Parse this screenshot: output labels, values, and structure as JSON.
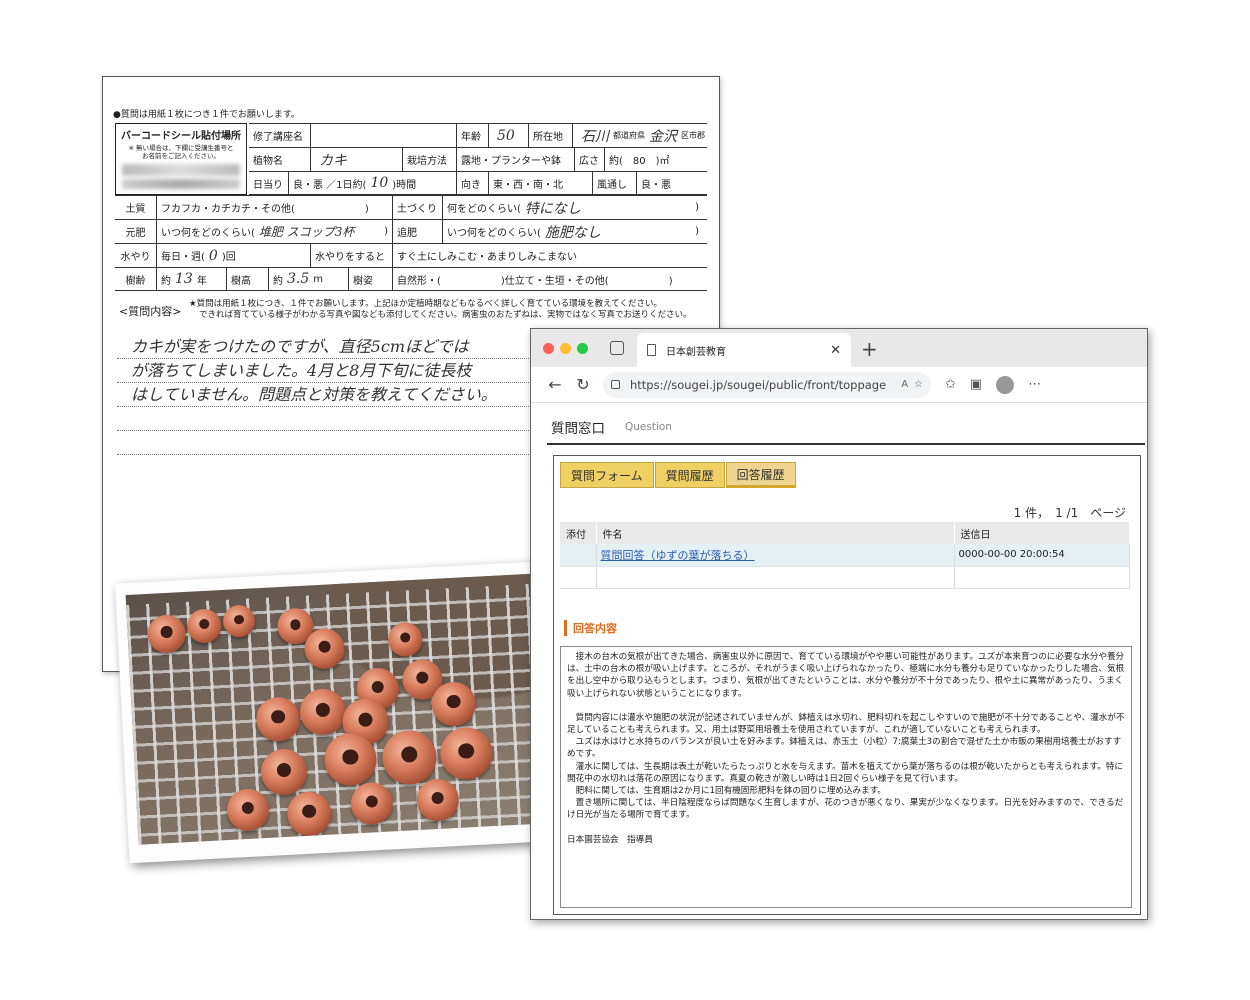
{
  "paper": {
    "notice": "●質問は用紙１枚につき１件でお願いします。",
    "barcode_title": "バーコードシール貼付場所",
    "barcode_note_1": "※ 無い場合は、下欄に受講生番号と",
    "barcode_note_2": "お名前をご記入ください。",
    "row1": {
      "course_label": "修了講座名",
      "age_label": "年齢",
      "age_value": "50",
      "loc_label": "所在地",
      "pref": "石川",
      "pref_suffix": "都道府県",
      "city": "金沢",
      "city_suffix": "区市郡"
    },
    "row2": {
      "plant_label": "植物名",
      "plant_value": "カキ",
      "method_label": "栽培方法",
      "method_value": "露地・プランターや鉢",
      "area_label": "広さ",
      "area_value": "約(　80　)㎡"
    },
    "row3": {
      "sun_label": "日当り",
      "sun_value": "良・悪 ／1日約(",
      "hours": "10",
      "hours_suffix": ")時間",
      "dir_label": "向き",
      "dir_value": "東・西・南・北",
      "wind_label": "風通し",
      "wind_value": "良・悪"
    },
    "soil": {
      "label": "土質",
      "value": "フカフカ・カチカチ・その他(　　　　　　　)",
      "prep_label": "土づくり",
      "prep_q": "何をどのくらい(",
      "prep_a": "特になし",
      "close": ")"
    },
    "fert": {
      "label": "元肥",
      "q": "いつ何をどのくらい(",
      "a": "堆肥 スコップ3杯",
      "close": ")",
      "top_label": "追肥",
      "top_q": "いつ何をどのくらい(",
      "top_a": "施肥なし"
    },
    "water": {
      "label": "水やり",
      "value": "毎日・週(",
      "count": "0",
      "suffix": ")回",
      "effect_label": "水やりをすると",
      "effect_value": "すぐ土にしみこむ・あまりしみこまない"
    },
    "tree": {
      "age_label": "樹齢",
      "age_pre": "約",
      "age": "13",
      "age_suffix": "年",
      "height_label": "樹高",
      "height_pre": "約",
      "height": "3.5",
      "height_suffix": "m",
      "shape_label": "樹姿",
      "shape_value": "自然形・(　　　　　　)仕立て・生垣・その他(　　　　　　)"
    },
    "question_label": "<質問内容>",
    "question_note_1": "★質問は用紙１枚につき、１件でお願いします。上記ほか定植時期などもなるべく詳しく育てている環境を教えてください。",
    "question_note_2": "できれば育てている様子がわかる写真や図なども添付してください。病害虫のおたずねは、実物ではなく写真でお送りください。",
    "question_lines": [
      "カキが実をつけたのですが、直径5cmほどでは",
      "が落ちてしまいました。4月と8月下旬に徒長枝",
      "はしていません。問題点と対策を教えてください。",
      "",
      ""
    ],
    "footer_mark": "※"
  },
  "browser": {
    "tab_title": "日本創芸教育",
    "url": "https://sougei.jp/sougei/public/front/toppage",
    "page_title": "質問窓口",
    "page_subtitle": "Question",
    "tabs": [
      "質問フォーム",
      "質問履歴",
      "回答履歴"
    ],
    "pager": "1 件，　1 /1　ページ",
    "table_headers": [
      "添付",
      "件名",
      "送信日"
    ],
    "rows": [
      {
        "attach": "",
        "subject": "質問回答（ゆずの葉が落ちる）",
        "date": "0000-00-00 20:00:54"
      }
    ],
    "answer_heading": "回答内容",
    "answer_paragraphs": [
      "　接木の台木の気根が出てきた場合、病害虫以外に原因で、育てている環境がやや悪い可能性があります。ユズが本来育つのに必要な水分や養分は、土中の台木の根が吸い上げます。ところが、それがうまく吸い上げられなかったり、極端に水分も養分も足りていなかったりした場合、気根を出し空中から取り込もうとします。つまり、気根が出てきたということは、水分や養分が不十分であったり、根や土に異常があったり、うまく吸い上げられない状態ということになります。",
      "",
      "　質問内容には灌水や施肥の状況が記述されていませんが、鉢植えは水切れ、肥料切れを起こしやすいので施肥が不十分であることや、灌水が不足していることも考えられます。又、用土は野菜用培養土を使用されていますが、これが適していないことも考えられます。",
      "　ユズは水はけと水持ちのバランスが良い土を好みます。鉢植えは、赤玉土（小粒）7:腐葉土3の割合で混ぜた土か市販の果樹用培養土がおすすめです。",
      "　灌水に関しては、生長期は表土が乾いたらたっぷりと水を与えます。苗木を植えてから葉が落ちるのは根が乾いたからとも考えられます。特に開花中の水切れは落花の原因になります。真夏の乾きが激しい時は1日2回ぐらい様子を見て行います。",
      "　肥料に関しては、生育期は2か月に1回有機固形肥料を鉢の回りに埋め込みます。",
      "　置き場所に関しては、半日陰程度ならば問題なく生育しますが、花のつきが悪くなり、果実が少なくなります。日光を好みますので、できるだけ日光が当たる場所で育てます。"
    ],
    "answer_sign": "日本園芸協会　指導員"
  },
  "colors": {
    "tab_gold": "#f0cf63",
    "accent_orange": "#e06b1f",
    "link_blue": "#2a5db0"
  }
}
